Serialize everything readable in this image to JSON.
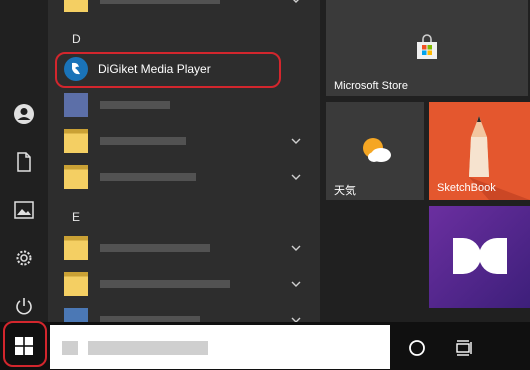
{
  "start_menu": {
    "headers": {
      "d": "D",
      "e": "E"
    },
    "highlighted_app": {
      "label": "DiGiket Media Player",
      "icon": "digiket-logo-icon"
    }
  },
  "tiles": {
    "store": {
      "label": "Microsoft Store",
      "icon": "shopping-bag-icon"
    },
    "weather": {
      "label": "天気",
      "icon": "weather-sun-cloud-icon"
    },
    "sketchbook": {
      "label": "SketchBook",
      "icon": "pencil-icon"
    },
    "dolby": {
      "label": "",
      "icon": "dolby-icon"
    }
  },
  "taskbar": {
    "start_icon": "windows-logo-icon",
    "cortana_icon": "circle-icon",
    "task_view_icon": "task-view-icon"
  },
  "colors": {
    "highlight": "#d3262d",
    "store_tile": "#3a3a3a",
    "weather_tile": "#3a3a3a",
    "sketchbook_tile": "#e4572e",
    "dolby_tile": "#5a2c8f"
  }
}
